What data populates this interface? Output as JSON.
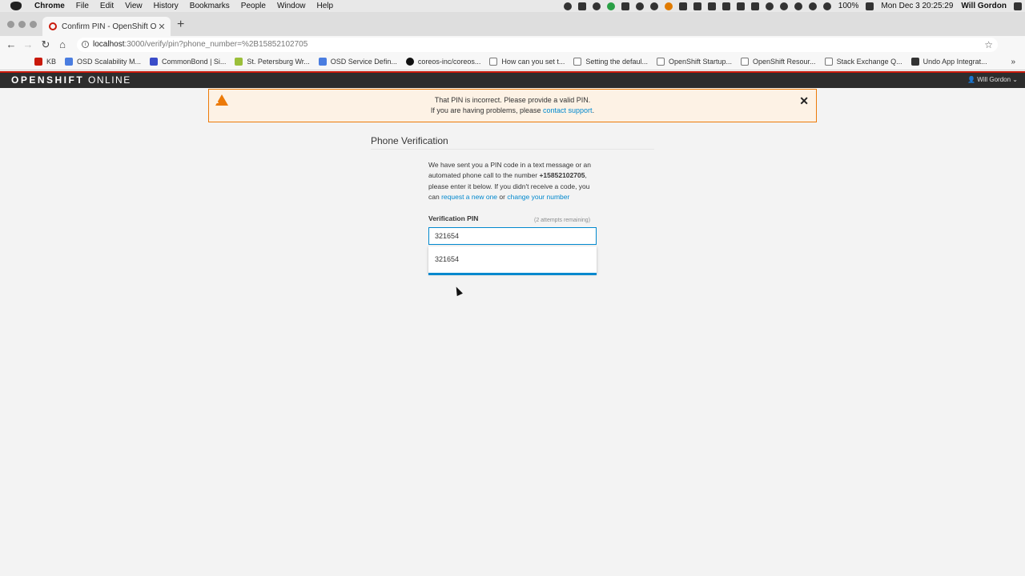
{
  "menubar": {
    "app": "Chrome",
    "items": [
      "File",
      "Edit",
      "View",
      "History",
      "Bookmarks",
      "People",
      "Window",
      "Help"
    ],
    "battery": "100%",
    "datetime": "Mon Dec 3  20:25:29",
    "user": "Will Gordon"
  },
  "browser": {
    "tab_title": "Confirm PIN - OpenShift Online",
    "url_host": "localhost",
    "url_path": ":3000/verify/pin?phone_number=%2B15852102705",
    "bookmarks": [
      "KB",
      "OSD Scalability M...",
      "CommonBond | Si...",
      "St. Petersburg Wr...",
      "OSD Service Defin...",
      "coreos-inc/coreos...",
      "How can you set t...",
      "Setting the defaul...",
      "OpenShift Startup...",
      "OpenShift Resour...",
      "Stack Exchange Q...",
      "Undo App Integrat..."
    ]
  },
  "header": {
    "logo_bold": "OPENSHIFT",
    "logo_light": "ONLINE",
    "user": "Will Gordon"
  },
  "alert": {
    "line1": "That PIN is incorrect. Please provide a valid PIN.",
    "line2_prefix": "If you are having problems, please",
    "link": "contact support",
    "line2_suffix": "."
  },
  "main": {
    "heading": "Phone Verification",
    "text_before_number": "We have sent you a PIN code in a text message or an automated phone call to the number",
    "phone_number": "+15852102705",
    "text_after_number": ", please enter it below. If you didn't receive a code, you can",
    "link_request": "request a new one",
    "text_or": "or",
    "link_change": "change your number",
    "pin_label": "Verification PIN",
    "attempts": "(2 attempts remaining)",
    "pin_value": "321654",
    "autocomplete_option": "321654"
  },
  "colors": {
    "accent": "#0088ce",
    "alert_border": "#ec7a08",
    "header_bg": "#2d2d2d",
    "brand_red": "#c9190b"
  }
}
